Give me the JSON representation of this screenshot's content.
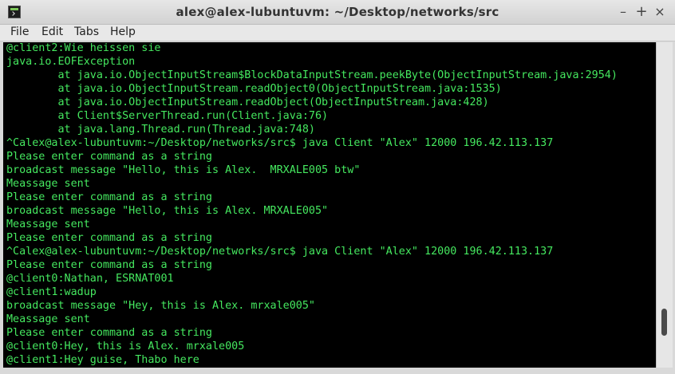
{
  "window": {
    "title": "alex@alex-lubuntuvm: ~/Desktop/networks/src",
    "controls": {
      "minimize": "–",
      "maximize": "+",
      "close": "×"
    }
  },
  "menu": {
    "file": "File",
    "edit": "Edit",
    "tabs": "Tabs",
    "help": "Help"
  },
  "terminal": {
    "lines": [
      "@client2:Wie heissen sie",
      "java.io.EOFException",
      "        at java.io.ObjectInputStream$BlockDataInputStream.peekByte(ObjectInputStream.java:2954)",
      "        at java.io.ObjectInputStream.readObject0(ObjectInputStream.java:1535)",
      "        at java.io.ObjectInputStream.readObject(ObjectInputStream.java:428)",
      "        at Client$ServerThread.run(Client.java:76)",
      "        at java.lang.Thread.run(Thread.java:748)",
      "^Calex@alex-lubuntuvm:~/Desktop/networks/src$ java Client \"Alex\" 12000 196.42.113.137",
      "Please enter command as a string",
      "broadcast message \"Hello, this is Alex.  MRXALE005 btw\"",
      "Meassage sent",
      "Please enter command as a string",
      "broadcast message \"Hello, this is Alex. MRXALE005\"",
      "Meassage sent",
      "Please enter command as a string",
      "^Calex@alex-lubuntuvm:~/Desktop/networks/src$ java Client \"Alex\" 12000 196.42.113.137",
      "Please enter command as a string",
      "@client0:Nathan, ESRNAT001",
      "@client1:wadup",
      "broadcast message \"Hey, this is Alex. mrxale005\"",
      "Meassage sent",
      "Please enter command as a string",
      "@client0:Hey, this is Alex. mrxale005",
      "@client1:Hey guise, Thabo here"
    ]
  },
  "colors": {
    "terminal_bg": "#000000",
    "terminal_fg": "#45e85f"
  }
}
